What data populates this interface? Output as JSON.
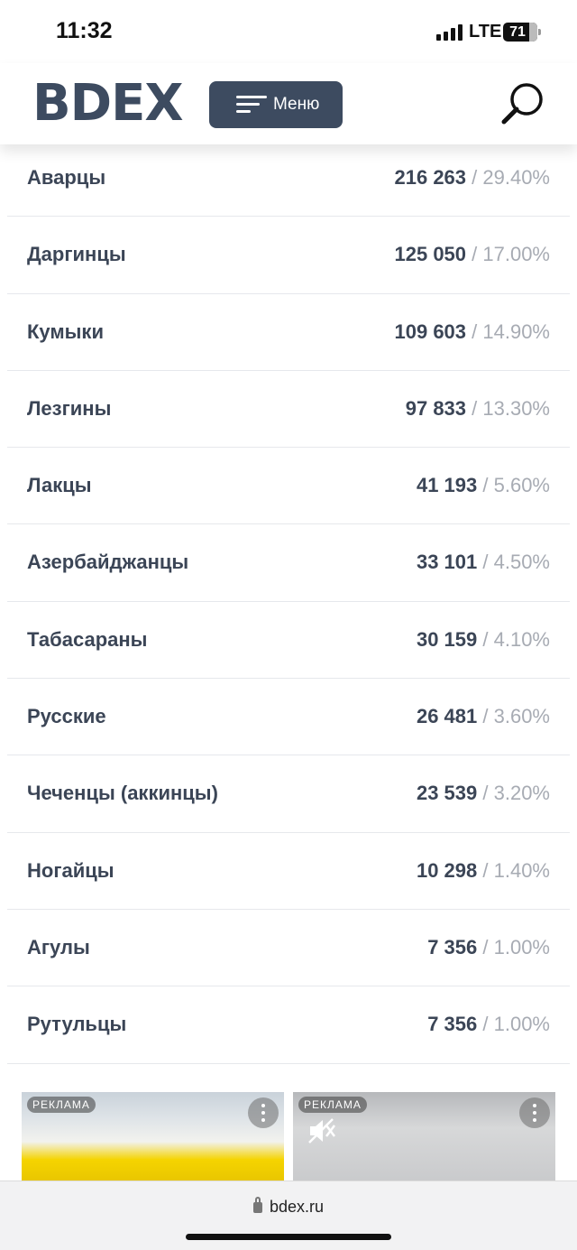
{
  "status_bar": {
    "time": "11:32",
    "network": "LTE",
    "battery": "71"
  },
  "header": {
    "logo": "BDEX",
    "menu_label": "Меню"
  },
  "rows": [
    {
      "name": "Аварцы",
      "value": "216 263",
      "percent": "/ 29.40%"
    },
    {
      "name": "Даргинцы",
      "value": "125 050",
      "percent": "/ 17.00%"
    },
    {
      "name": "Кумыки",
      "value": "109 603",
      "percent": "/ 14.90%"
    },
    {
      "name": "Лезгины",
      "value": "97 833",
      "percent": "/ 13.30%"
    },
    {
      "name": "Лакцы",
      "value": "41 193",
      "percent": "/ 5.60%"
    },
    {
      "name": "Азербайджанцы",
      "value": "33 101",
      "percent": "/ 4.50%"
    },
    {
      "name": "Табасараны",
      "value": "30 159",
      "percent": "/ 4.10%"
    },
    {
      "name": "Русские",
      "value": "26 481",
      "percent": "/ 3.60%"
    },
    {
      "name": "Чеченцы (аккинцы)",
      "value": "23 539",
      "percent": "/ 3.20%"
    },
    {
      "name": "Ногайцы",
      "value": "10 298",
      "percent": "/ 1.40%"
    },
    {
      "name": "Агулы",
      "value": "7 356",
      "percent": "/ 1.00%"
    },
    {
      "name": "Рутульцы",
      "value": "7 356",
      "percent": "/ 1.00%"
    }
  ],
  "ads": [
    {
      "label": "РЕКЛАМА"
    },
    {
      "label": "РЕКЛАМА"
    }
  ],
  "browser": {
    "url": "bdex.ru"
  },
  "colors": {
    "brand": "#3d4b60",
    "percent_gray": "#a7abb3"
  }
}
